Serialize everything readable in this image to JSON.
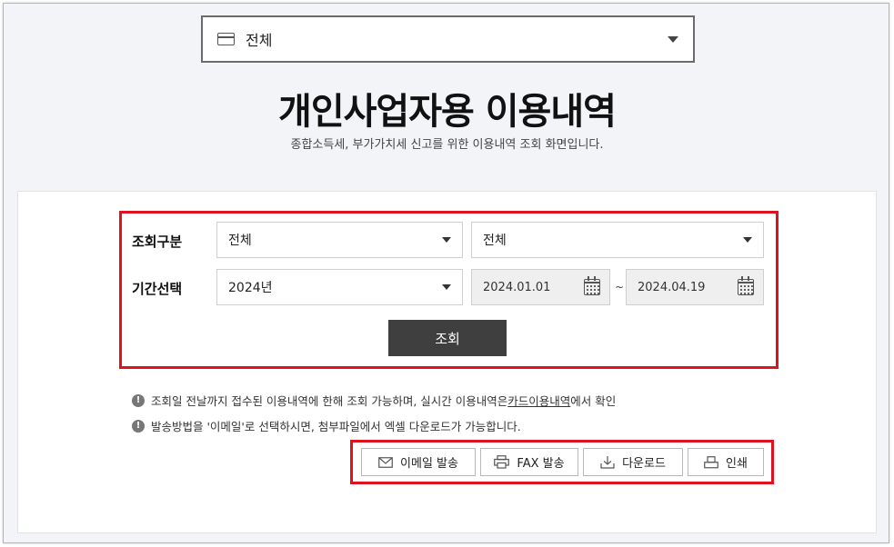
{
  "card_selector": {
    "value": "전체",
    "icon": "card-icon"
  },
  "header": {
    "title": "개인사업자용 이용내역",
    "subtitle": "종합소득세, 부가가치세 신고를 위한 이용내역 조회 화면입니다."
  },
  "form": {
    "query_type": {
      "label": "조회구분",
      "select1": "전체",
      "select2": "전체"
    },
    "period": {
      "label": "기간선택",
      "year": "2024년",
      "start_date": "2024.01.01",
      "separator": "~",
      "end_date": "2024.04.19"
    },
    "search_button": "조회"
  },
  "notes": {
    "note1_prefix": "조회일 전날까지 접수된 이용내역에 한해 조회 가능하며, 실시간 이용내역은 ",
    "note1_link": "카드이용내역",
    "note1_suffix": "에서 확인",
    "note2": "발송방법을 '이메일'로 선택하시면, 첨부파일에서 엑셀 다운로드가 가능합니다.",
    "icon_text": "!"
  },
  "actions": {
    "email": "이메일 발송",
    "fax": "FAX 발송",
    "download": "다운로드",
    "print": "인쇄"
  },
  "colors": {
    "highlight": "#e0121f",
    "button_dark": "#3f3f3f",
    "page_bg": "#f2f4f8"
  }
}
